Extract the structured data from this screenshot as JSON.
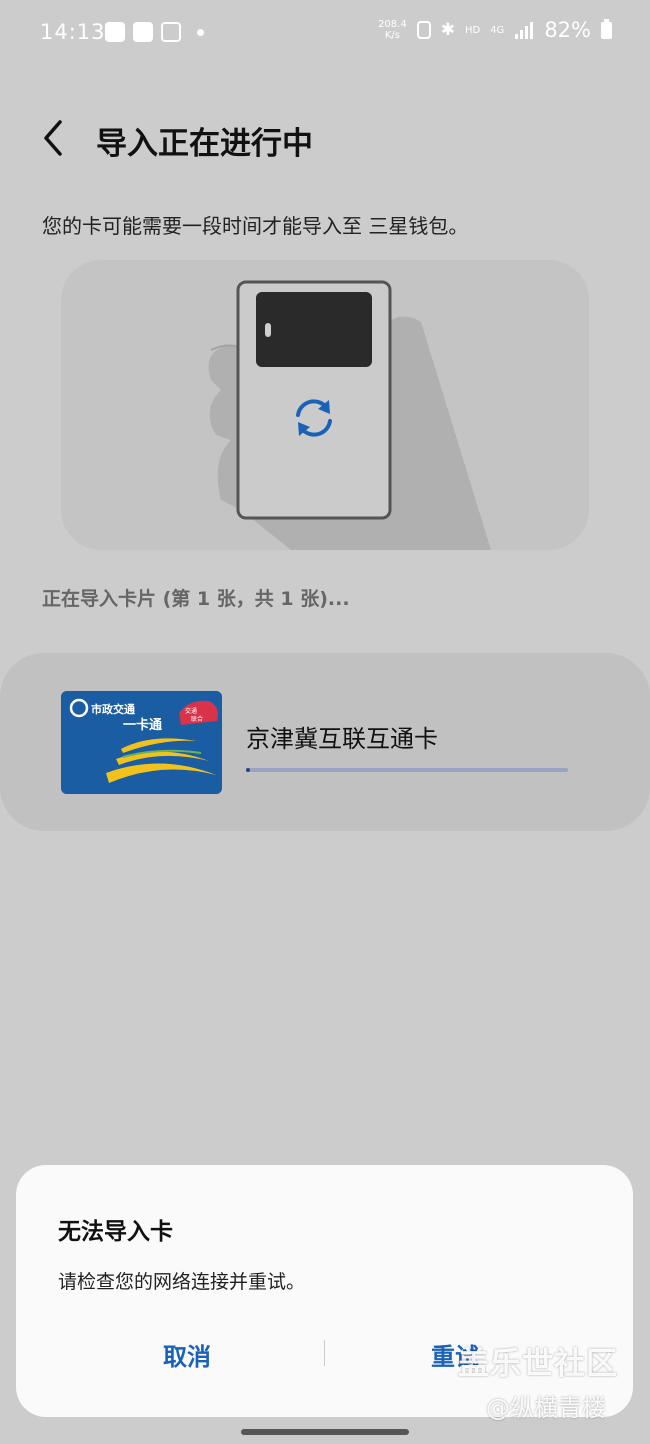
{
  "status_bar": {
    "time": "14:13",
    "net_speed_value": "208.4",
    "net_speed_unit": "K/s",
    "hd_label": "HD",
    "network_type": "4G",
    "battery_percent": "82%"
  },
  "header": {
    "title": "导入正在进行中"
  },
  "description": "您的卡可能需要一段时间才能导入至 三星钱包。",
  "progress_text": "正在导入卡片 (第 1 张，共 1 张)...",
  "card": {
    "name": "京津冀互联互通卡",
    "thumb_text_top": "市政交通",
    "thumb_text_main": "一卡通",
    "thumb_badge_top": "交通",
    "thumb_badge_bottom": "联合",
    "import_progress": 0.01
  },
  "dialog": {
    "title": "无法导入卡",
    "message": "请检查您的网络连接并重试。",
    "cancel_label": "取消",
    "retry_label": "重试"
  },
  "watermark": {
    "main": "盖乐世社区",
    "sub": "@纵横青楼"
  },
  "colors": {
    "accent": "#1a62b8",
    "progress_fill": "#2c3f8a",
    "card_blue": "#1a5da3",
    "sync_icon": "#1a62b8"
  }
}
